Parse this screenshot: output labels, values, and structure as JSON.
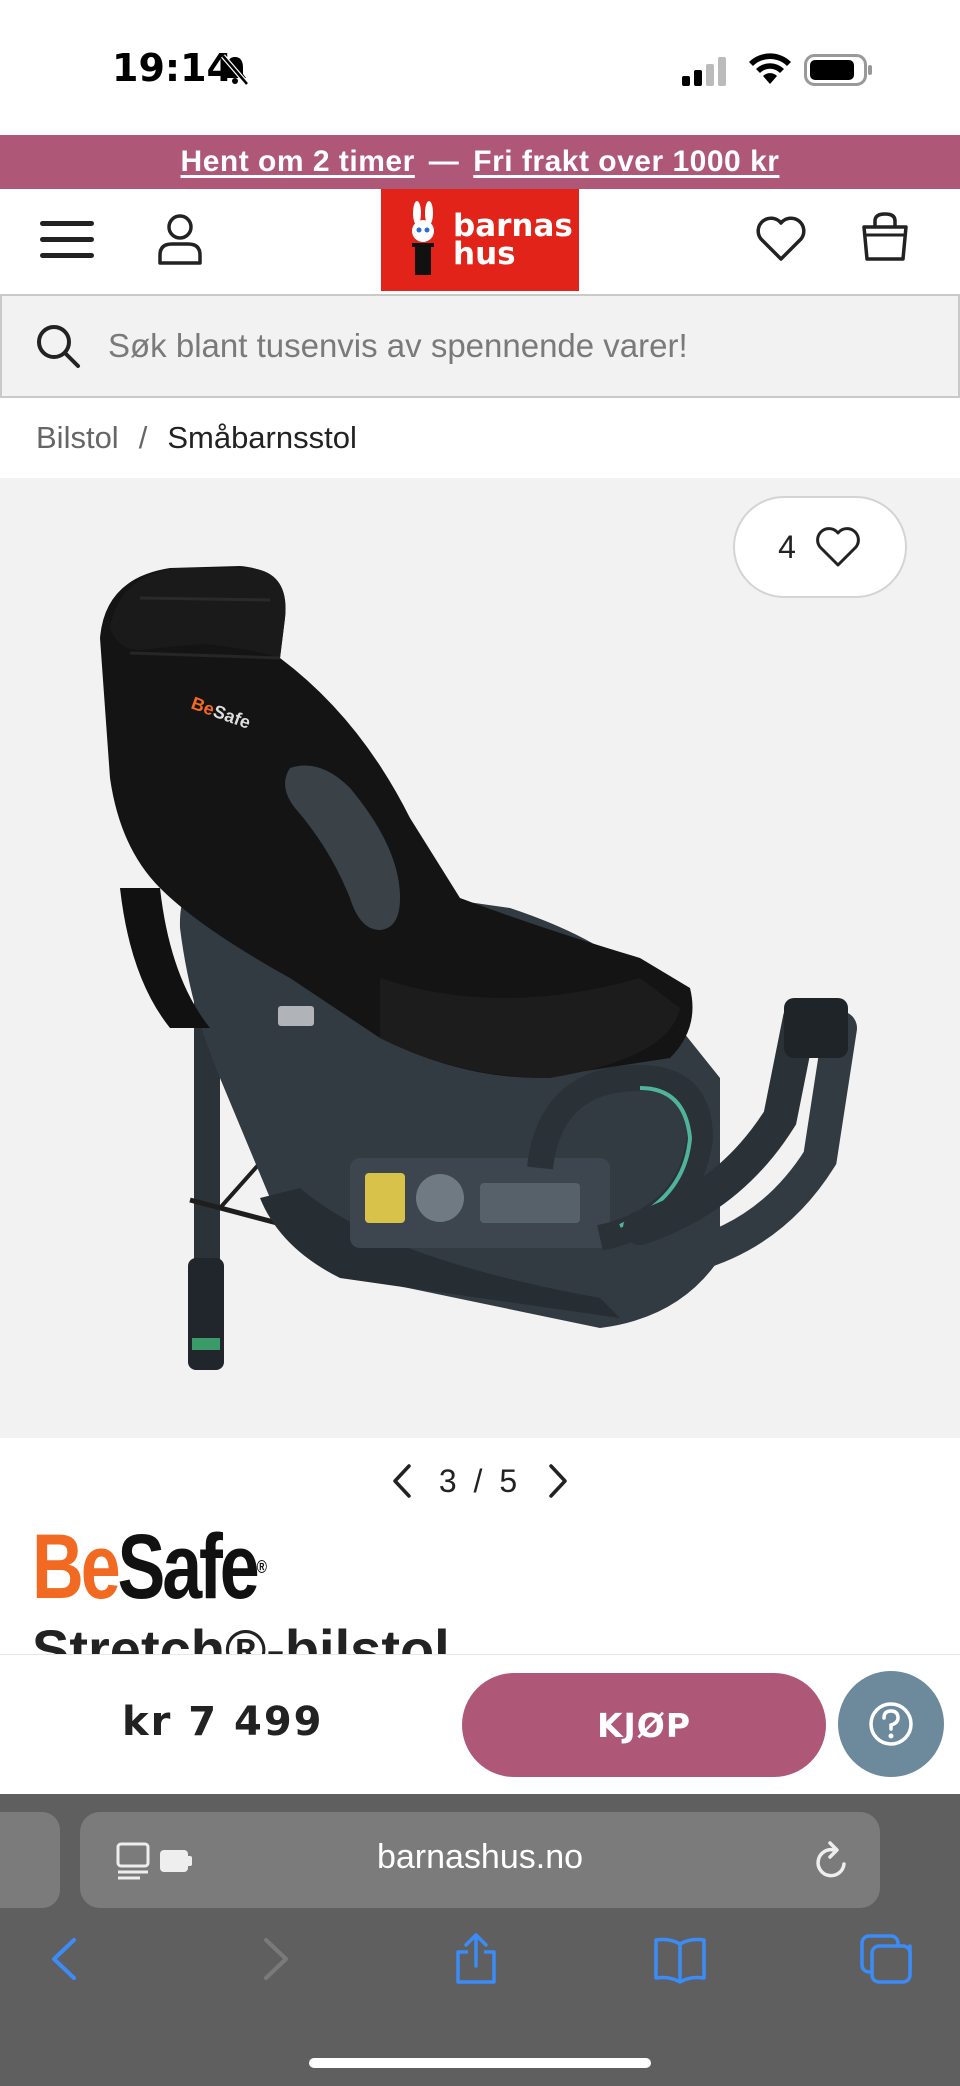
{
  "status_bar": {
    "time": "19:14"
  },
  "promo": {
    "part1": "Hent om 2 timer",
    "separator": "—",
    "part2": "Fri frakt over 1000 kr"
  },
  "header": {
    "logo_line1": "barnas",
    "logo_line2": "hus"
  },
  "search": {
    "placeholder": "Søk blant tusenvis av spennende varer!"
  },
  "breadcrumb": {
    "parent": "Bilstol",
    "separator": "/",
    "current": "Småbarnsstol"
  },
  "gallery": {
    "favorite_count": "4",
    "pager": "3 / 5"
  },
  "product": {
    "brand_be": "Be",
    "brand_safe": "Safe",
    "brand_reg": "®",
    "title_partial": "Stretch®-bilstol"
  },
  "buy_bar": {
    "price": "kr 7 499",
    "buy_label": "KJØP"
  },
  "safari": {
    "url": "barnashus.no"
  },
  "colors": {
    "accent": "#ae5776",
    "logo_red": "#e2231a",
    "help": "#6c8a9c",
    "brand_orange": "#f26a21"
  },
  "icons": [
    "bell-off-icon",
    "signal-icon",
    "wifi-icon",
    "battery-icon",
    "menu-icon",
    "user-icon",
    "heart-icon",
    "bag-icon",
    "search-icon",
    "chevron-left-icon",
    "chevron-right-icon",
    "help-icon",
    "reader-icon",
    "reload-icon",
    "back-icon",
    "forward-icon",
    "share-icon",
    "bookmarks-icon",
    "tabs-icon"
  ]
}
